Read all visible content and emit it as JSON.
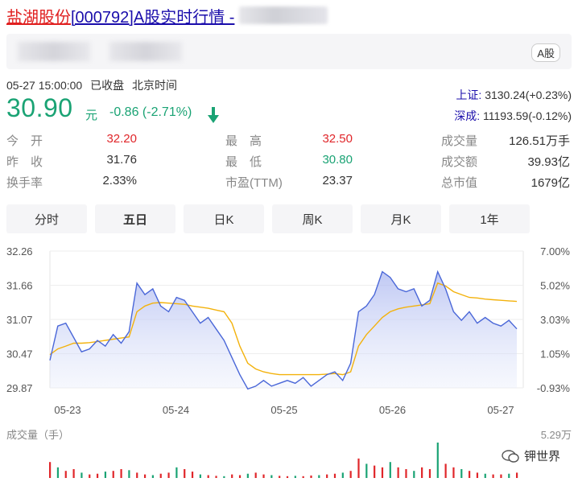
{
  "title": {
    "name": "盐湖股份",
    "code_part": "[000792]A股实时行情 -"
  },
  "badge": "A股",
  "status": {
    "datetime": "05-27 15:00:00",
    "state": "已收盘",
    "zone": "北京时间"
  },
  "quote": {
    "price": "30.90",
    "unit": "元",
    "change": "-0.86 (-2.71%)"
  },
  "indices": [
    {
      "name": "上证:",
      "value": "3130.24(+0.23%)"
    },
    {
      "name": "深成:",
      "value": "11193.59(-0.12%)"
    }
  ],
  "stats": [
    {
      "label": "今　开",
      "value": "32.20",
      "color": "#e0262a"
    },
    {
      "label": "最　高",
      "value": "32.50",
      "color": "#e0262a"
    },
    {
      "label": "成交量",
      "value": "126.51万手",
      "color": "#333333"
    },
    {
      "label": "昨　收",
      "value": "31.76",
      "color": "#333333"
    },
    {
      "label": "最　低",
      "value": "30.80",
      "color": "#1aa374"
    },
    {
      "label": "成交额",
      "value": "39.93亿",
      "color": "#333333"
    },
    {
      "label": "换手率",
      "value": "2.33%",
      "color": "#333333"
    },
    {
      "label": "市盈(TTM)",
      "value": "23.37",
      "color": "#333333"
    },
    {
      "label": "总市值",
      "value": "1679亿",
      "color": "#333333"
    }
  ],
  "tabs": [
    "分时",
    "五日",
    "日K",
    "周K",
    "月K",
    "1年"
  ],
  "active_tab": "五日",
  "volume": {
    "label": "成交量（手）",
    "max": "5.29万"
  },
  "watermark": "钾世界",
  "chart_data": {
    "type": "line",
    "y_ticks": [
      "32.26",
      "31.66",
      "31.07",
      "30.47",
      "29.87"
    ],
    "y_pct_ticks": [
      "7.00%",
      "5.02%",
      "3.03%",
      "1.05%",
      "-0.93%"
    ],
    "x_ticks": [
      "05-23",
      "05-24",
      "05-25",
      "05-26",
      "05-27"
    ],
    "ylim": [
      29.87,
      32.26
    ],
    "series": [
      {
        "color": "#4a67d8",
        "values": [
          30.35,
          30.95,
          31.0,
          30.75,
          30.5,
          30.55,
          30.7,
          30.6,
          30.8,
          30.65,
          30.85,
          31.7,
          31.5,
          31.6,
          31.3,
          31.2,
          31.45,
          31.4,
          31.2,
          31.0,
          31.1,
          30.9,
          30.7,
          30.4,
          30.1,
          29.85,
          29.9,
          30.0,
          29.9,
          29.95,
          30.0,
          29.95,
          30.05,
          29.9,
          30.0,
          30.1,
          30.15,
          30.0,
          30.3,
          31.2,
          31.3,
          31.5,
          31.9,
          31.8,
          31.6,
          31.55,
          31.6,
          31.3,
          31.4,
          31.9,
          31.6,
          31.2,
          31.05,
          31.2,
          31.0,
          31.1,
          31.0,
          30.95,
          31.05,
          30.9
        ]
      },
      {
        "color": "#f3b20c",
        "values": [
          30.45,
          30.55,
          30.6,
          30.65,
          30.65,
          30.66,
          30.68,
          30.7,
          30.72,
          30.74,
          30.76,
          31.2,
          31.3,
          31.35,
          31.36,
          31.35,
          31.34,
          31.33,
          31.3,
          31.28,
          31.26,
          31.23,
          31.2,
          31.0,
          30.6,
          30.3,
          30.2,
          30.15,
          30.12,
          30.1,
          30.1,
          30.1,
          30.1,
          30.1,
          30.1,
          30.11,
          30.12,
          30.1,
          30.15,
          30.6,
          30.8,
          30.95,
          31.1,
          31.2,
          31.25,
          31.28,
          31.3,
          31.32,
          31.34,
          31.7,
          31.65,
          31.55,
          31.5,
          31.45,
          31.44,
          31.42,
          31.41,
          31.4,
          31.39,
          31.38
        ]
      }
    ],
    "volume_bars": [
      0.45,
      0.3,
      0.2,
      0.25,
      0.15,
      0.1,
      0.12,
      0.18,
      0.2,
      0.25,
      0.22,
      0.15,
      0.1,
      0.08,
      0.12,
      0.15,
      0.3,
      0.25,
      0.18,
      0.1,
      0.08,
      0.06,
      0.05,
      0.1,
      0.08,
      0.12,
      0.15,
      0.1,
      0.08,
      0.06,
      0.05,
      0.06,
      0.05,
      0.07,
      0.08,
      0.1,
      0.12,
      0.15,
      0.2,
      0.55,
      0.4,
      0.35,
      0.3,
      0.45,
      0.3,
      0.25,
      0.2,
      0.3,
      0.25,
      1.0,
      0.4,
      0.3,
      0.25,
      0.2,
      0.15,
      0.12,
      0.1,
      0.1,
      0.12,
      0.15
    ]
  }
}
